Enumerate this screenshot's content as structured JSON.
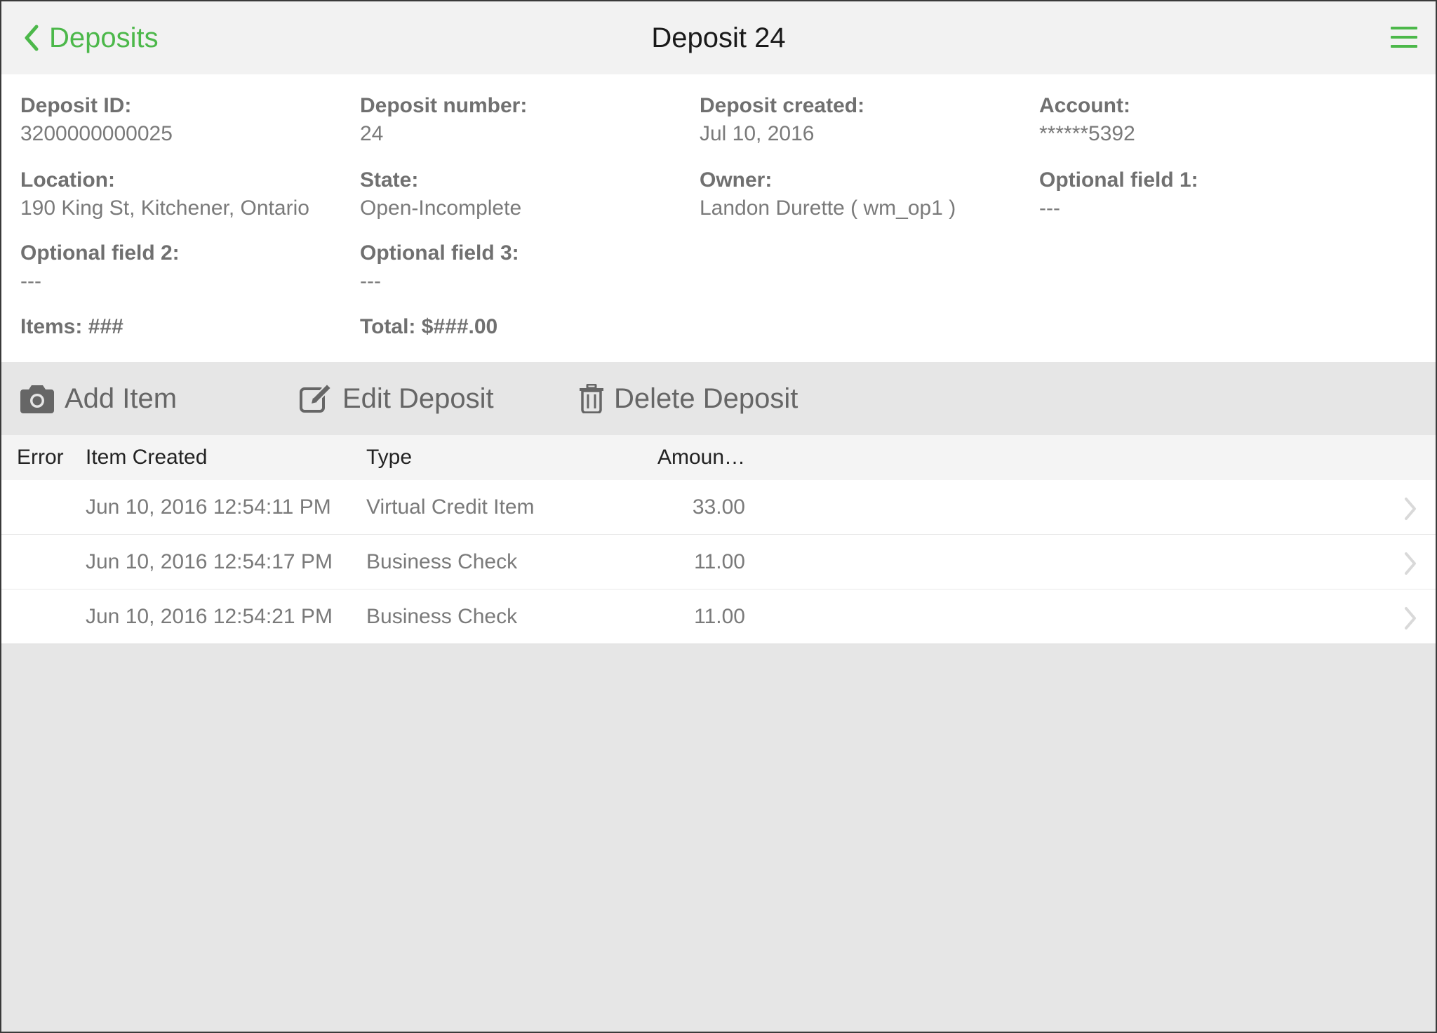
{
  "navbar": {
    "back_label": "Deposits",
    "title": "Deposit 24",
    "back_icon": "chevron-left-icon",
    "menu_icon": "hamburger-menu-icon",
    "accent_color": "#4cb84a"
  },
  "details": {
    "deposit_id": {
      "label": "Deposit ID:",
      "value": "3200000000025"
    },
    "deposit_number": {
      "label": "Deposit number:",
      "value": "24"
    },
    "deposit_created": {
      "label": "Deposit created:",
      "value": "Jul 10, 2016"
    },
    "account": {
      "label": "Account:",
      "value": "******5392"
    },
    "location": {
      "label": "Location:",
      "value": "190 King St, Kitchener, Ontario"
    },
    "state": {
      "label": "State:",
      "value": "Open-Incomplete"
    },
    "owner": {
      "label": "Owner:",
      "value": "Landon Durette ( wm_op1 )"
    },
    "optional_field_1": {
      "label": "Optional field 1:",
      "value": "---"
    },
    "optional_field_2": {
      "label": "Optional field 2:",
      "value": "---"
    },
    "optional_field_3": {
      "label": "Optional field 3:",
      "value": "---"
    },
    "items_summary": "Items: ###",
    "total_summary": "Total: $###.00"
  },
  "toolbar": {
    "add_item": {
      "label": "Add Item",
      "icon": "camera-icon"
    },
    "edit_deposit": {
      "label": "Edit Deposit",
      "icon": "edit-icon"
    },
    "delete_deposit": {
      "label": "Delete Deposit",
      "icon": "trash-icon"
    }
  },
  "table": {
    "headers": {
      "error": "Error",
      "item_created": "Item Created",
      "type": "Type",
      "amount": "Amoun…"
    },
    "rows": [
      {
        "error": "",
        "created": "Jun 10, 2016 12:54:11 PM",
        "type": "Virtual Credit Item",
        "amount": "33.00"
      },
      {
        "error": "",
        "created": "Jun 10, 2016 12:54:17 PM",
        "type": "Business Check",
        "amount": "11.00"
      },
      {
        "error": "",
        "created": "Jun 10, 2016 12:54:21 PM",
        "type": "Business Check",
        "amount": "11.00"
      }
    ],
    "row_icon": "chevron-right-icon"
  }
}
